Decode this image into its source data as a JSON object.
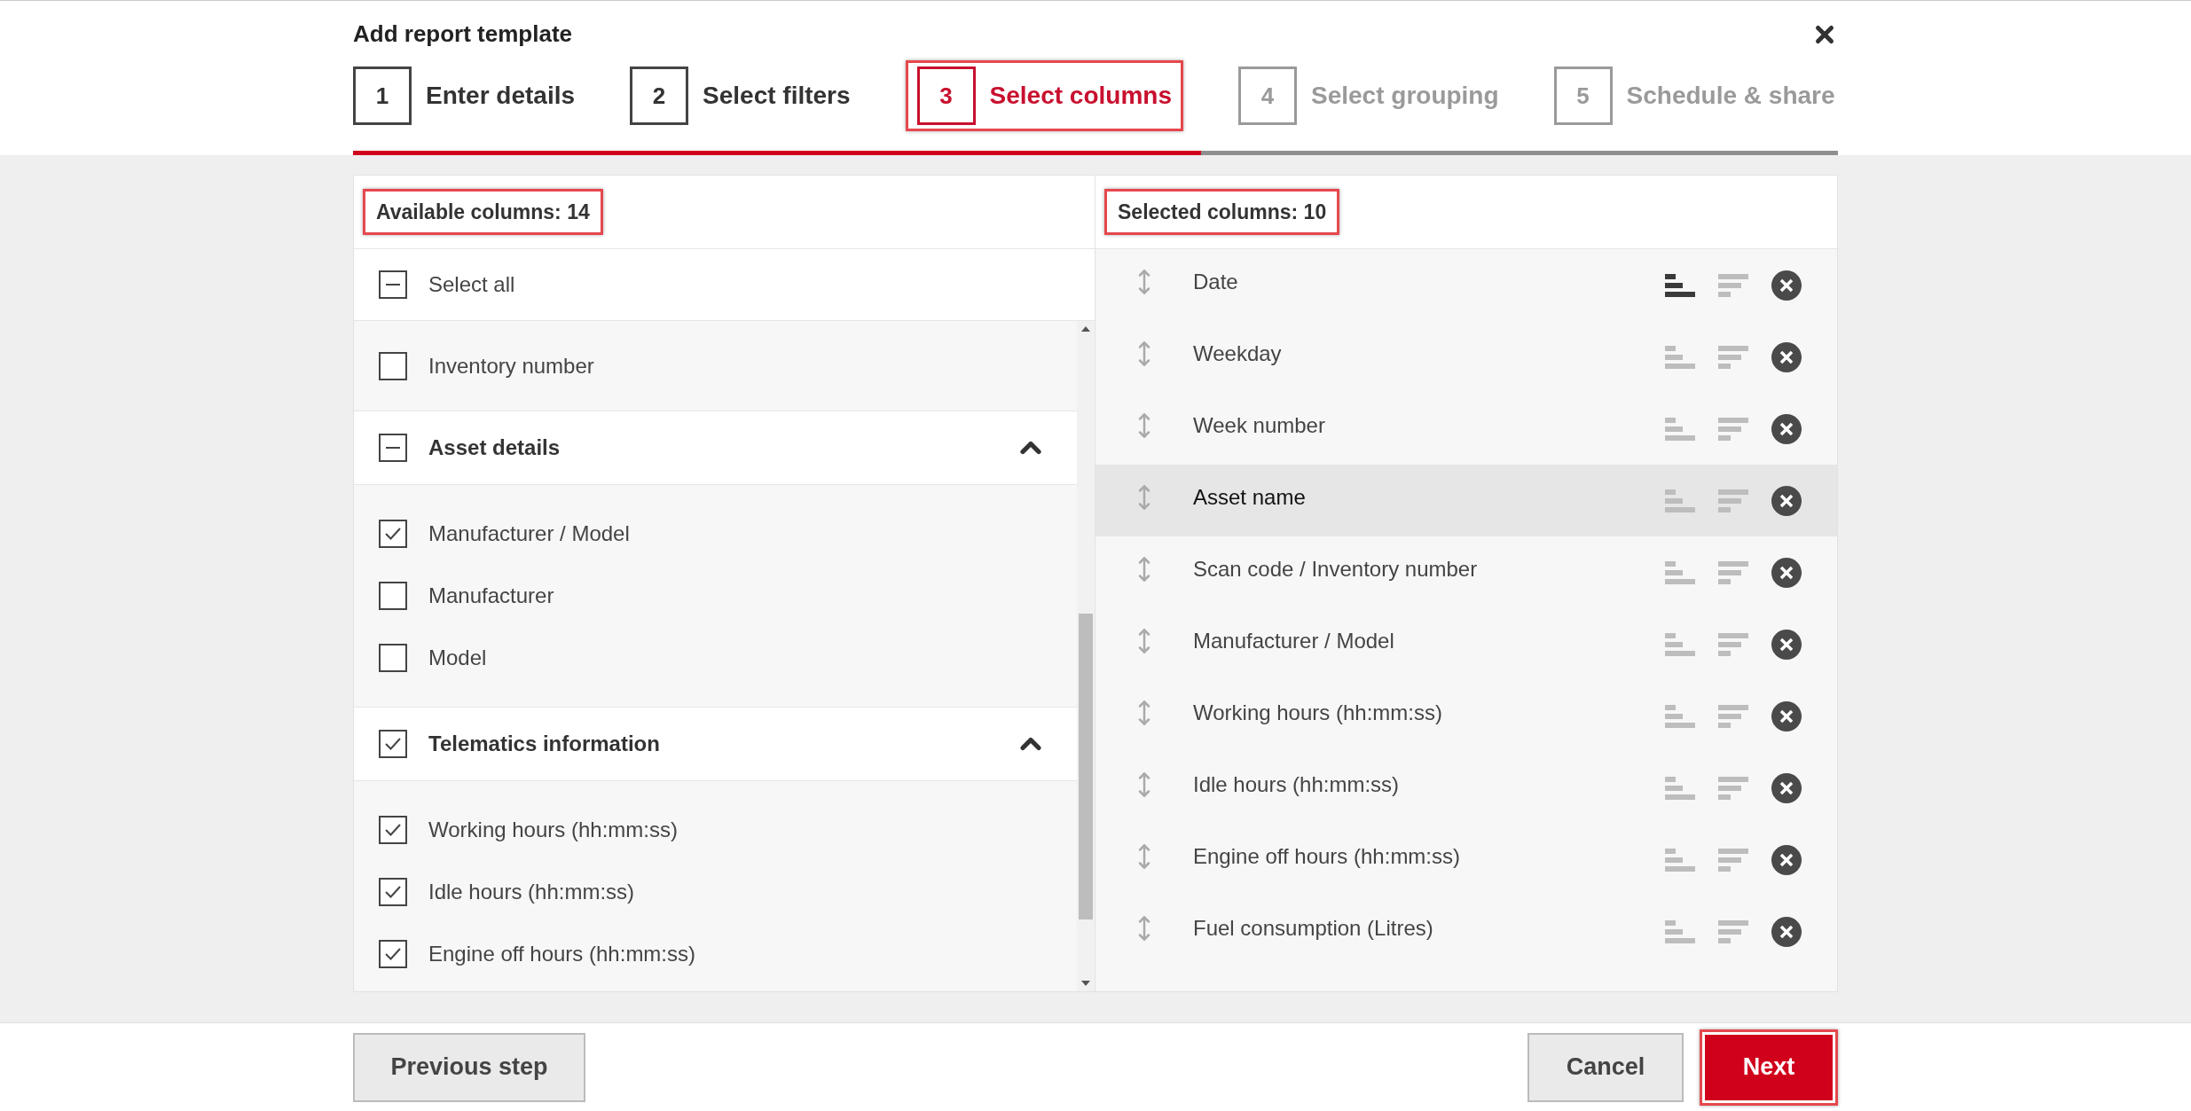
{
  "dialog": {
    "title": "Add report template"
  },
  "steps": [
    {
      "number": "1",
      "label": "Enter details",
      "completed": true,
      "selected": false,
      "highlighted": false
    },
    {
      "number": "2",
      "label": "Select filters",
      "completed": true,
      "selected": false,
      "highlighted": false
    },
    {
      "number": "3",
      "label": "Select columns",
      "selected": true,
      "highlighted": true
    },
    {
      "number": "4",
      "label": "Select grouping",
      "completed": false,
      "selected": false,
      "highlighted": false
    },
    {
      "number": "5",
      "label": "Schedule & share",
      "completed": false,
      "selected": false,
      "highlighted": false
    }
  ],
  "progress": {
    "level": 0.571
  },
  "available_columns": {
    "title": "Available columns: 14",
    "highlighted": true,
    "select_all": {
      "label": "Select all",
      "indeterminate": true
    },
    "items": [
      {
        "kind": "item",
        "label": "Inventory number",
        "checked": false
      },
      {
        "kind": "group",
        "label": "Asset details",
        "indeterminate": true,
        "expanded": true,
        "children": [
          {
            "label": "Manufacturer / Model",
            "checked": true
          },
          {
            "label": "Manufacturer",
            "checked": false
          },
          {
            "label": "Model",
            "checked": false
          }
        ]
      },
      {
        "kind": "group",
        "label": "Telematics information",
        "checked": true,
        "expanded": true,
        "children": [
          {
            "label": "Working hours (hh:mm:ss)",
            "checked": true
          },
          {
            "label": "Idle hours (hh:mm:ss)",
            "checked": true
          },
          {
            "label": "Engine off hours (hh:mm:ss)",
            "checked": true
          }
        ]
      }
    ]
  },
  "selected_columns": {
    "title": "Selected columns: 10",
    "highlighted": true,
    "rows": [
      {
        "label": "Date",
        "hovered": false,
        "sort_active": true
      },
      {
        "label": "Weekday",
        "hovered": false,
        "sort_active": false
      },
      {
        "label": "Week number",
        "hovered": false,
        "sort_active": false
      },
      {
        "label": "Asset name",
        "hovered": true,
        "sort_active": false
      },
      {
        "label": "Scan code / Inventory number",
        "hovered": false,
        "sort_active": false
      },
      {
        "label": "Manufacturer / Model",
        "hovered": false,
        "sort_active": false
      },
      {
        "label": "Working hours (hh:mm:ss)",
        "hovered": false,
        "sort_active": false
      },
      {
        "label": "Idle hours (hh:mm:ss)",
        "hovered": false,
        "sort_active": false
      },
      {
        "label": "Engine off hours (hh:mm:ss)",
        "hovered": false,
        "sort_active": false
      },
      {
        "label": "Fuel consumption (Litres)",
        "hovered": false,
        "sort_active": false
      }
    ]
  },
  "footer": {
    "previous": {
      "label": "Previous step"
    },
    "cancel": {
      "label": "Cancel"
    },
    "next": {
      "label": "Next",
      "highlighted": true
    }
  }
}
